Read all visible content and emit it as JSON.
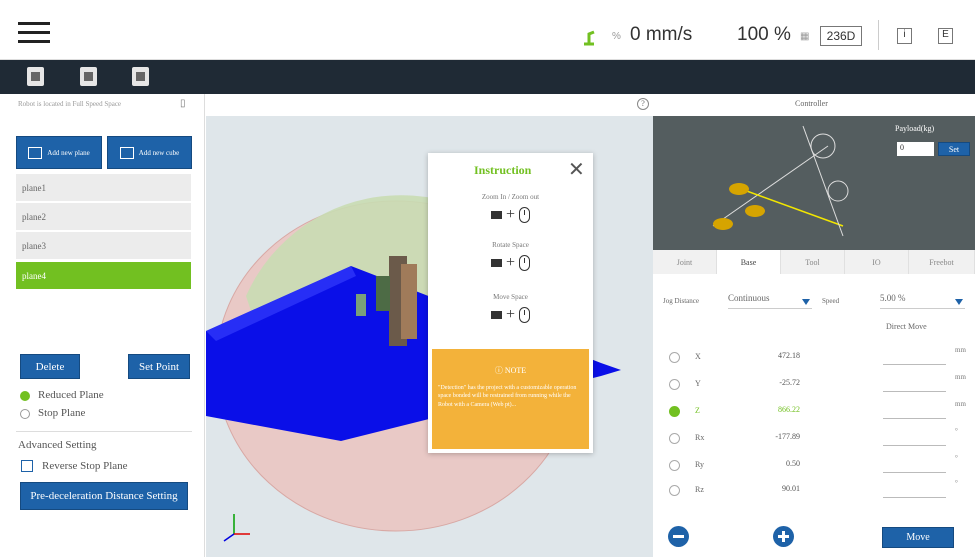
{
  "header": {
    "speed_value": "0 mm/s",
    "override_percent": "100 %",
    "project_tag": "236D",
    "info_label": "i",
    "menu_label": "E"
  },
  "left": {
    "status_note": "Robot is located in Full Speed Space",
    "add_plane_label": "Add new plane",
    "add_cube_label": "Add new cube",
    "planes": [
      "plane1",
      "plane2",
      "plane3",
      "plane4"
    ],
    "selected_plane": "plane4",
    "delete_label": "Delete",
    "set_point_label": "Set Point",
    "plane_types": [
      {
        "label": "Reduced Plane",
        "selected": true
      },
      {
        "label": "Stop Plane",
        "selected": false
      }
    ],
    "advanced_title": "Advanced Setting",
    "reverse_label": "Reverse Stop Plane",
    "pre_decel_label": "Pre-deceleration Distance Setting"
  },
  "instruction": {
    "title": "Instruction",
    "zoom_caption": "Zoom In / Zoom out",
    "rotate_caption": "Rotate Space",
    "move_caption": "Move Space",
    "note_title": "NOTE",
    "note_text": "\"Detection\" has the project with a customizable operation space bonded will be restrained from running while the Robot with a Camera (Web pt)..."
  },
  "right": {
    "controller_title": "Controller",
    "payload_label": "Payload(kg)",
    "payload_value": "0",
    "set_label": "Set",
    "tabs": [
      "Joint",
      "Base",
      "Tool",
      "IO",
      "Freebot"
    ],
    "active_tab": "Base",
    "jog_distance_label": "Jog Distance",
    "jog_distance_value": "Continuous",
    "speed_label": "Speed",
    "speed_value": "5.00 %",
    "direct_move_label": "Direct Move",
    "axes": [
      {
        "name": "X",
        "value": "472.18",
        "unit": "mm",
        "selected": false
      },
      {
        "name": "Y",
        "value": "-25.72",
        "unit": "mm",
        "selected": false
      },
      {
        "name": "Z",
        "value": "866.22",
        "unit": "mm",
        "selected": true
      },
      {
        "name": "Rx",
        "value": "-177.89",
        "unit": "°",
        "selected": false
      },
      {
        "name": "Ry",
        "value": "0.50",
        "unit": "°",
        "selected": false
      },
      {
        "name": "Rz",
        "value": "90.01",
        "unit": "°",
        "selected": false
      }
    ],
    "move_label": "Move"
  },
  "colors": {
    "accent_blue": "#1e62a8",
    "accent_green": "#72c021",
    "dark_bar": "#1f2a35",
    "note_orange": "#f3b23a"
  }
}
